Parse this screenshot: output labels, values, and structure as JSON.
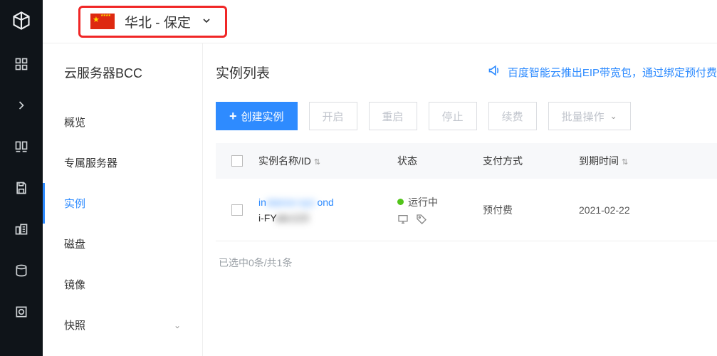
{
  "region": {
    "label": "华北 - 保定"
  },
  "nav": {
    "title": "云服务器BCC",
    "items": [
      {
        "label": "概览"
      },
      {
        "label": "专属服务器"
      },
      {
        "label": "实例"
      },
      {
        "label": "磁盘"
      },
      {
        "label": "镜像"
      },
      {
        "label": "快照"
      }
    ]
  },
  "content": {
    "title": "实例列表",
    "banner": "百度智能云推出EIP带宽包，通过绑定预付费"
  },
  "actions": {
    "create": "创建实例",
    "start": "开启",
    "restart": "重启",
    "stop": "停止",
    "renew": "续费",
    "batch": "批量操作"
  },
  "table": {
    "headers": {
      "name": "实例名称/ID",
      "status": "状态",
      "pay": "支付方式",
      "expire": "到期时间"
    },
    "row": {
      "name_link": "ins            ond",
      "name_sub": "i-FY           ",
      "status": "运行中",
      "pay": "预付费",
      "expire": "2021-02-22"
    },
    "footer": "已选中0条/共1条"
  }
}
